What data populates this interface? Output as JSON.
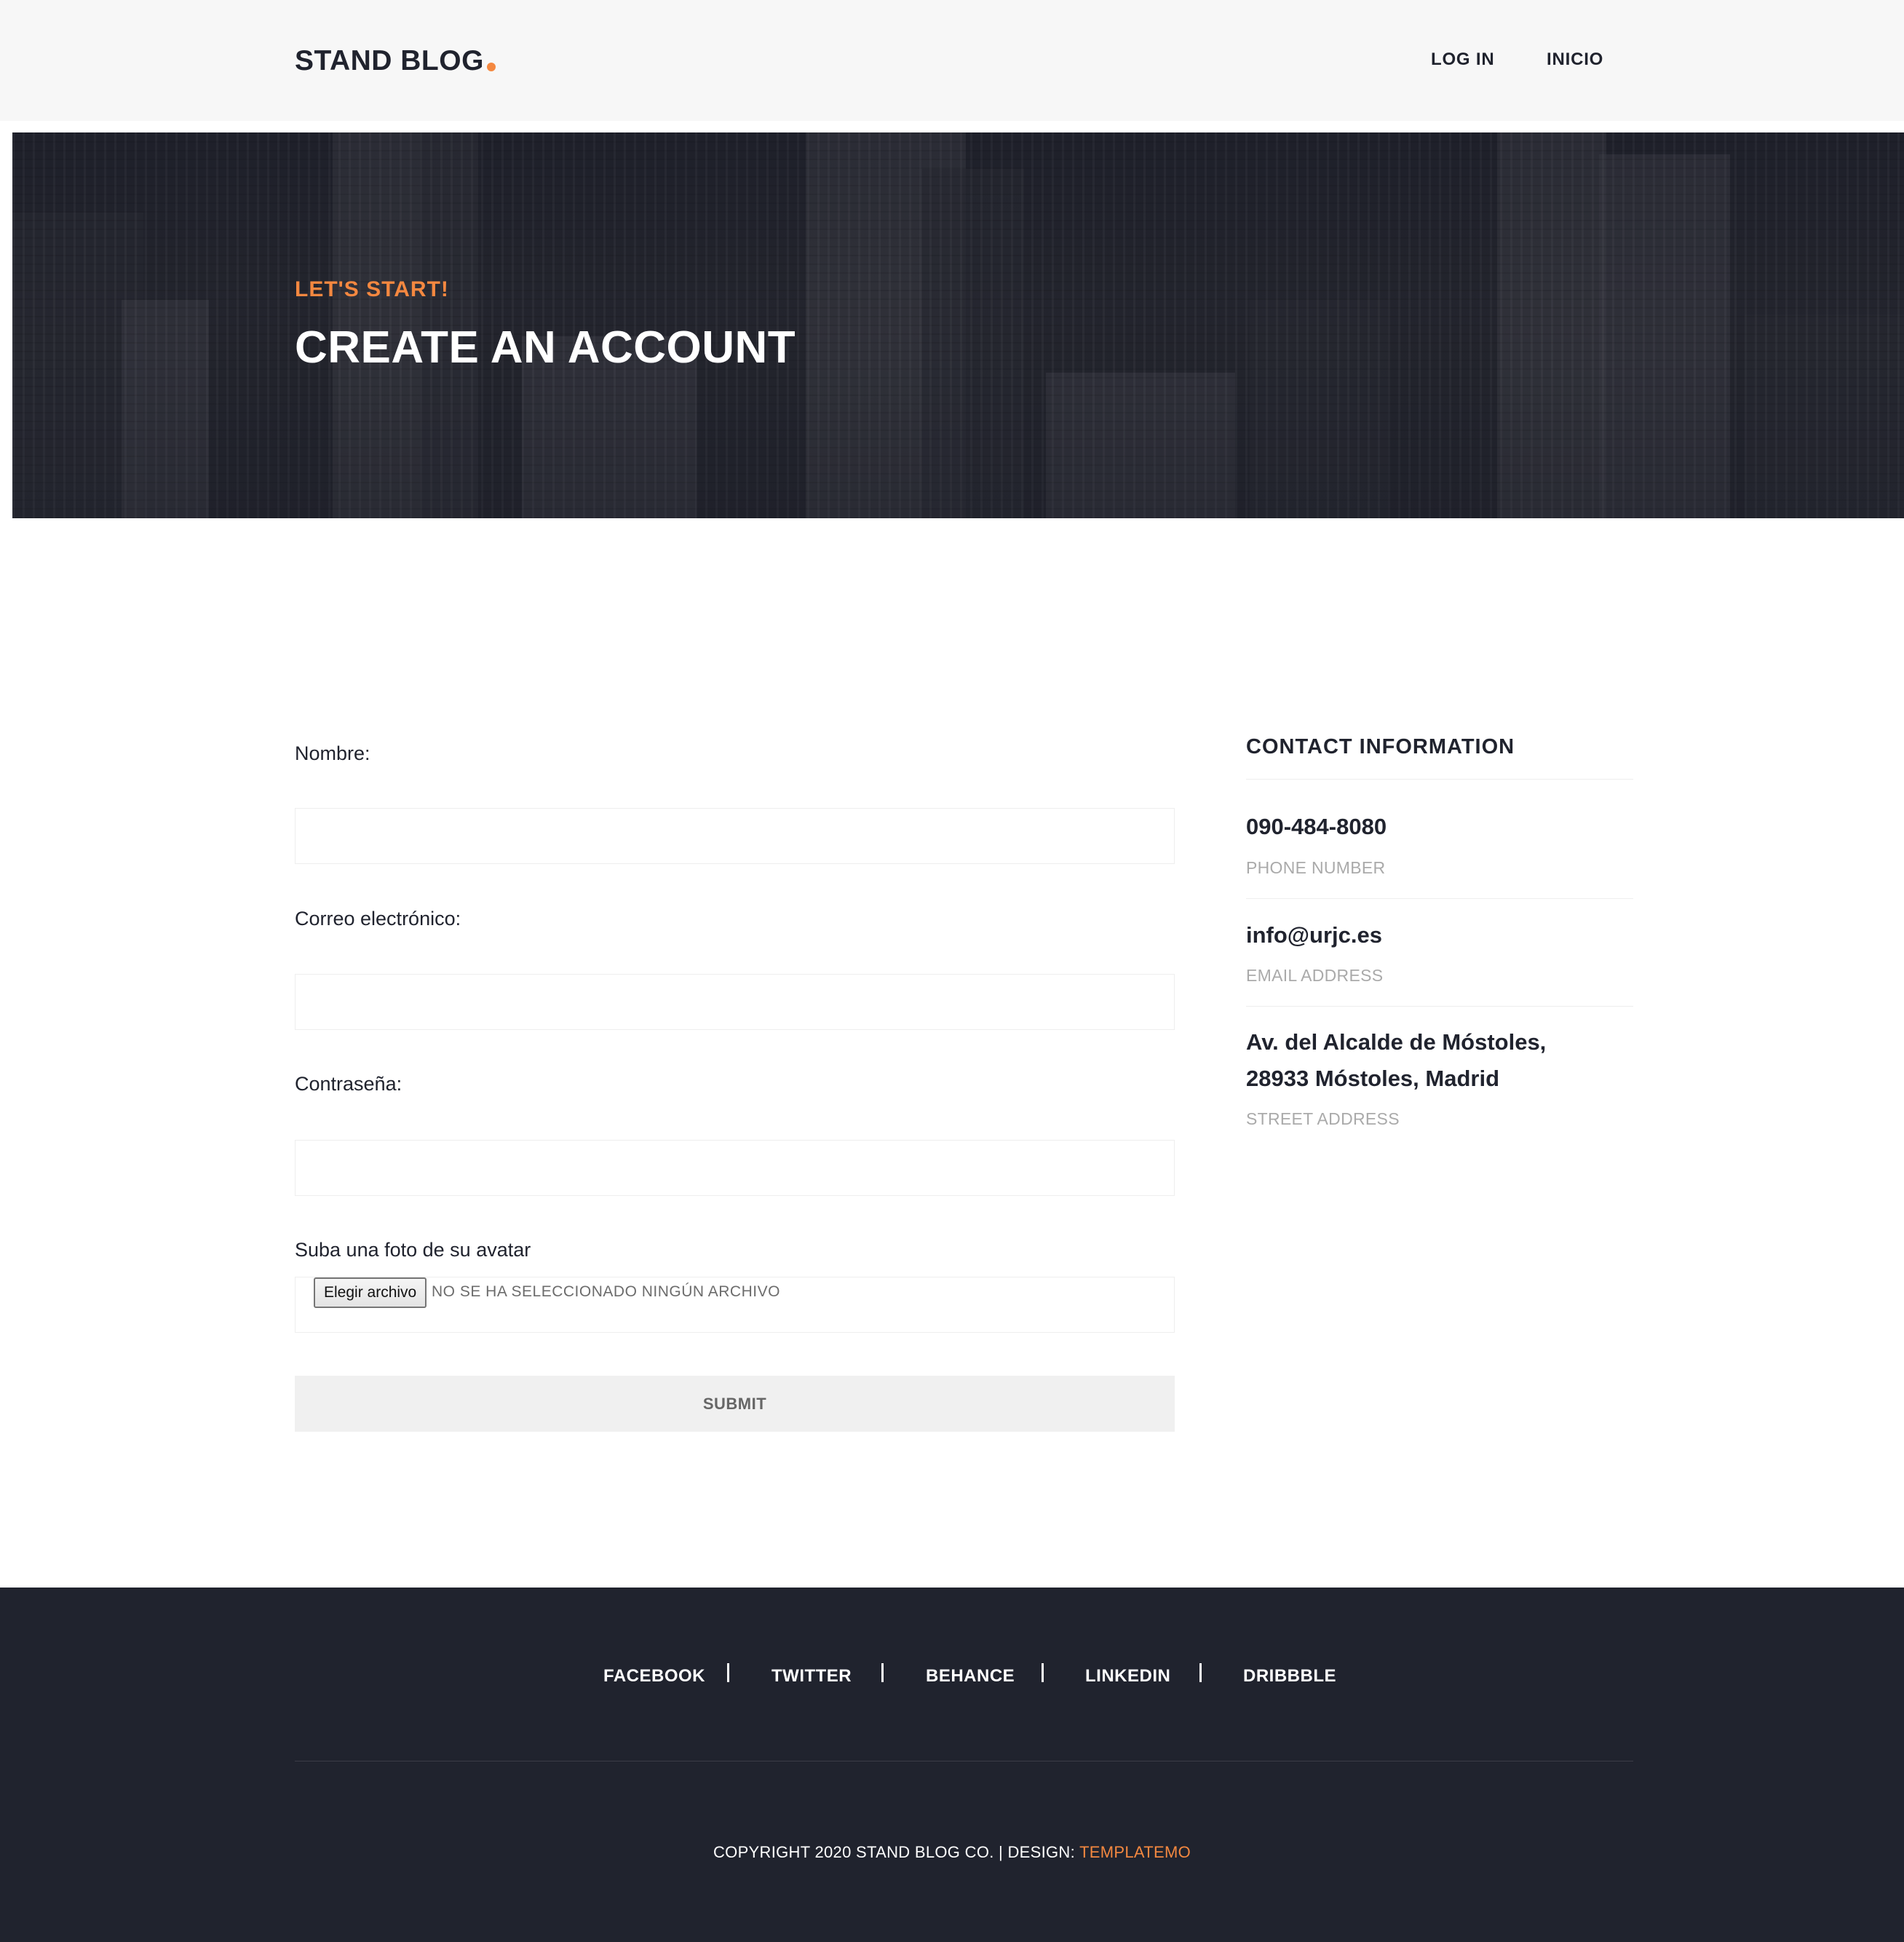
{
  "header": {
    "logo_text": "STAND BLOG",
    "nav": [
      {
        "label": "LOG IN"
      },
      {
        "label": "INICIO"
      }
    ]
  },
  "hero": {
    "kicker": "LET'S START!",
    "title": "CREATE AN ACCOUNT"
  },
  "form": {
    "name_label": "Nombre:",
    "name_value": "",
    "email_label": "Correo electrónico:",
    "email_value": "",
    "password_label": "Contraseña:",
    "password_value": "",
    "avatar_label": "Suba una foto de su avatar",
    "file_button_label": "Elegir archivo",
    "file_status": "NO SE HA SELECCIONADO NINGÚN ARCHIVO",
    "submit_label": "SUBMIT"
  },
  "contact": {
    "title": "CONTACT INFORMATION",
    "items": [
      {
        "value": "090-484-8080",
        "caption": "PHONE NUMBER"
      },
      {
        "value": "info@urjc.es",
        "caption": "EMAIL ADDRESS"
      },
      {
        "value_line1": "Av. del Alcalde de Móstoles,",
        "value_line2": "28933 Móstoles, Madrid",
        "caption": "STREET ADDRESS"
      }
    ]
  },
  "footer": {
    "social": [
      {
        "label": "FACEBOOK"
      },
      {
        "label": "TWITTER"
      },
      {
        "label": "BEHANCE"
      },
      {
        "label": "LINKEDIN"
      },
      {
        "label": "DRIBBBLE"
      }
    ],
    "separator": "|",
    "copyright_text": "COPYRIGHT 2020 STAND BLOG CO. | DESIGN: ",
    "copyright_link": "TEMPLATEMO"
  },
  "colors": {
    "accent": "#f48840",
    "dark": "#20232e",
    "header_bg": "#f7f7f7",
    "muted": "#aaaaaa"
  }
}
